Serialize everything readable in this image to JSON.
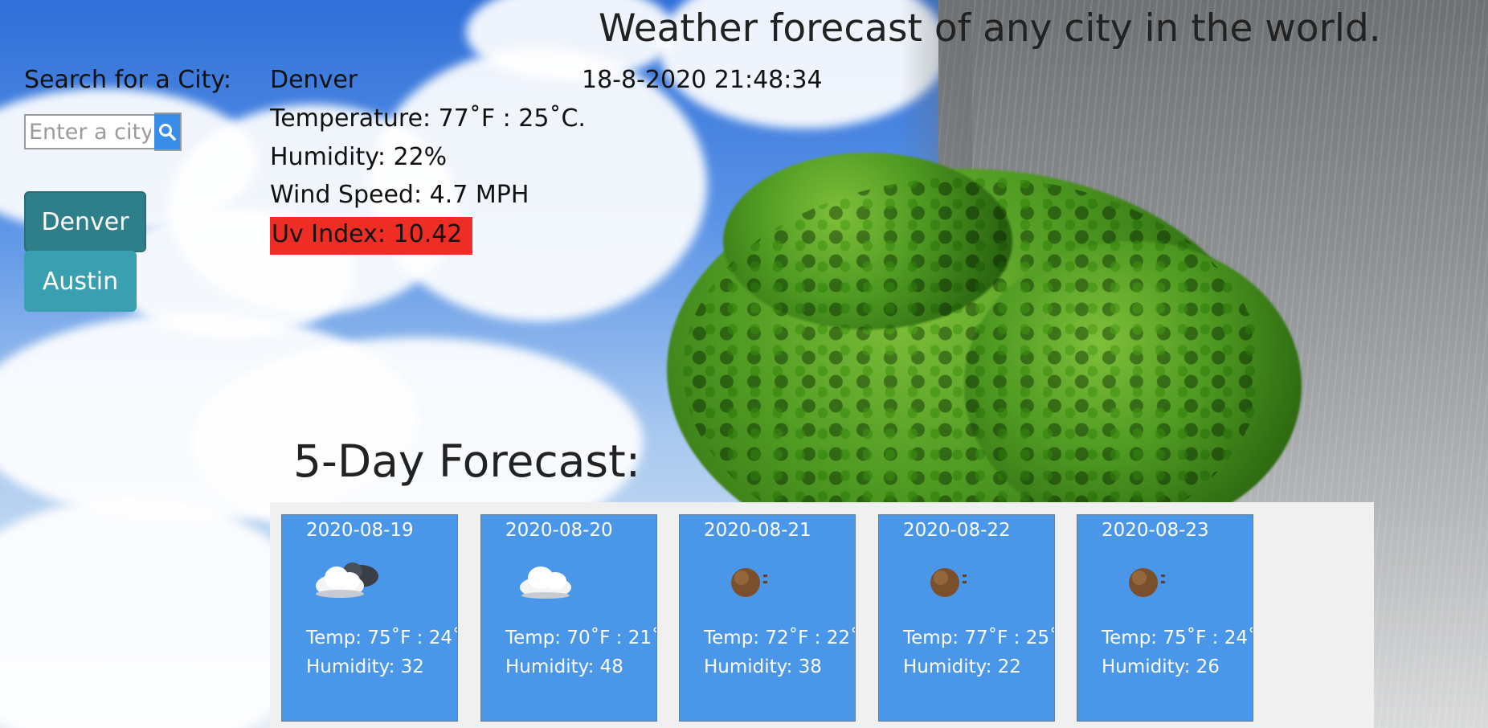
{
  "header": {
    "title": "Weather forecast of any city in the world."
  },
  "search": {
    "label": "Search for a City:",
    "placeholder": "Enter a city.",
    "value": "",
    "button_icon": "search-icon"
  },
  "history": [
    {
      "label": "Denver",
      "active": true
    },
    {
      "label": "Austin",
      "active": false
    }
  ],
  "current": {
    "city": "Denver",
    "datetime": "18-8-2020 21:48:34",
    "temperature": "Temperature: 77˚F : 25˚C.",
    "humidity": "Humidity: 22%",
    "wind": "Wind Speed: 4.7 MPH",
    "uv": "Uv Index: 10.42",
    "uv_color": "#ee2d24"
  },
  "forecast": {
    "title": "5-Day Forecast:",
    "days": [
      {
        "date": "2020-08-19",
        "icon": "cloud-night-icon",
        "temp": "Temp: 75˚F : 24˚",
        "humidity": "Humidity: 32"
      },
      {
        "date": "2020-08-20",
        "icon": "cloud-icon",
        "temp": "Temp: 70˚F : 21˚",
        "humidity": "Humidity: 48"
      },
      {
        "date": "2020-08-21",
        "icon": "moon-haze-icon",
        "temp": "Temp: 72˚F : 22˚",
        "humidity": "Humidity: 38"
      },
      {
        "date": "2020-08-22",
        "icon": "moon-haze-icon",
        "temp": "Temp: 77˚F : 25˚",
        "humidity": "Humidity: 22"
      },
      {
        "date": "2020-08-23",
        "icon": "moon-haze-icon",
        "temp": "Temp: 75˚F : 24˚",
        "humidity": "Humidity: 26"
      }
    ]
  },
  "colors": {
    "card_bg": "#4a97ea",
    "history_active": "#2f7f8b",
    "history_inactive": "#3a9fb1",
    "search_button": "#3a8ee8"
  }
}
